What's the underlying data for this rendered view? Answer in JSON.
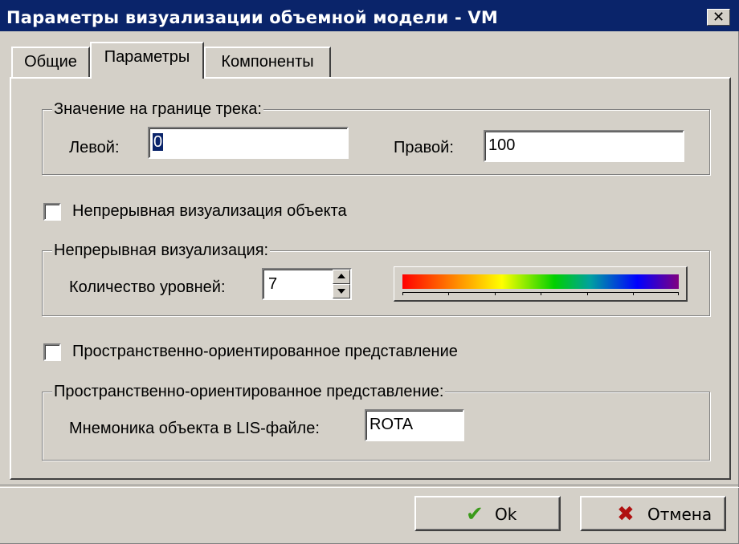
{
  "window": {
    "title": "Параметры визуализации объемной модели - VM",
    "close_symbol": "✕"
  },
  "tabs": [
    {
      "label": "Общие",
      "active": false
    },
    {
      "label": "Параметры",
      "active": true
    },
    {
      "label": "Компоненты",
      "active": false
    }
  ],
  "track_bounds": {
    "group_label": "Значение на границе трека:",
    "left_label": "Левой:",
    "left_value": "0",
    "right_label": "Правой:",
    "right_value": "100"
  },
  "continuous_checkbox": {
    "label": "Непрерывная визуализация объекта",
    "checked": false
  },
  "continuous_group": {
    "group_label": "Непрерывная визуализация:",
    "levels_label": "Количество уровней:",
    "levels_value": "7"
  },
  "spatial_checkbox": {
    "label": "Пространственно-ориентированное представление",
    "checked": false
  },
  "spatial_group": {
    "group_label": "Пространственно-ориентированное представление:",
    "mnemonic_label": "Мнемоника объекта в LIS-файле:",
    "mnemonic_value": "ROTA"
  },
  "buttons": {
    "ok": "Ok",
    "cancel": "Отмена"
  },
  "icons": {
    "close": "close-icon",
    "ok": "check-icon",
    "cancel": "cross-icon"
  },
  "colors": {
    "titlebar": "#0a246a",
    "face": "#d4d0c8",
    "ok_icon": "#3a9a1a",
    "cancel_icon": "#b01010"
  }
}
